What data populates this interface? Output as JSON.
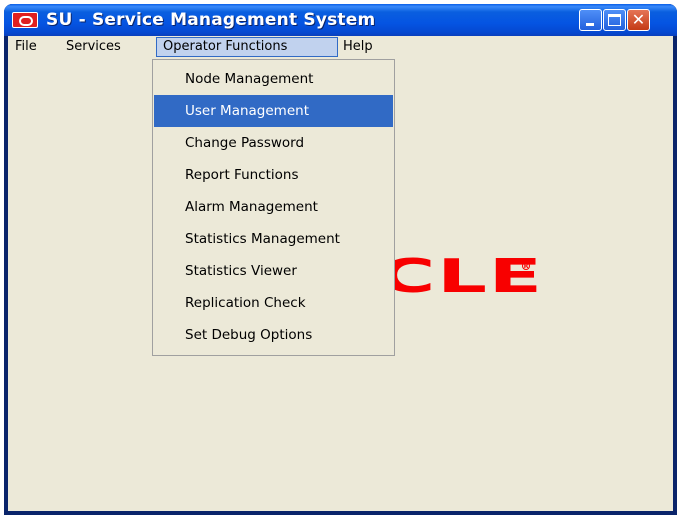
{
  "window": {
    "title": "SU - Service Management System",
    "controls": {
      "minimize_icon": "minimize-icon",
      "maximize_icon": "maximize-icon",
      "close_icon": "close-icon",
      "close_glyph": "✕"
    }
  },
  "menubar": {
    "items": [
      {
        "label": "File"
      },
      {
        "label": "Services"
      },
      {
        "label": "Operator Functions",
        "active": true
      },
      {
        "label": "Help"
      }
    ]
  },
  "operator_functions_menu": {
    "items": [
      {
        "label": "Node Management"
      },
      {
        "label": "User Management",
        "selected": true
      },
      {
        "label": "Change Password"
      },
      {
        "label": "Report Functions"
      },
      {
        "label": "Alarm Management"
      },
      {
        "label": "Statistics Management"
      },
      {
        "label": "Statistics Viewer"
      },
      {
        "label": "Replication Check"
      },
      {
        "label": "Set Debug Options"
      }
    ]
  },
  "background_logo": {
    "visible_text": "CLE",
    "registered_mark": "R",
    "color": "#f80000"
  },
  "colors": {
    "titlebar": "#0554e2",
    "client_bg": "#ece9d8",
    "selection": "#316ac5",
    "menu_active_bg": "#c1d2ee"
  }
}
